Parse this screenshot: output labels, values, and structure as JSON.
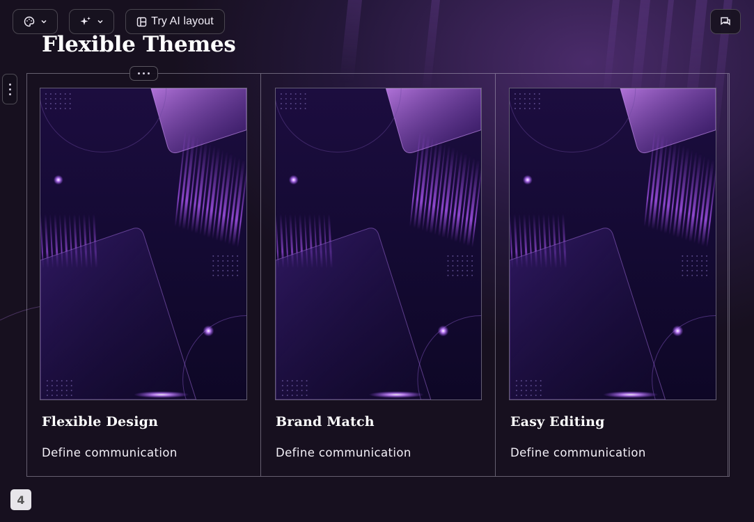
{
  "toolbar": {
    "theme_icon": "palette-icon",
    "ai_icon": "sparkles-icon",
    "layout_icon": "layout-icon",
    "layout_label": "Try AI layout",
    "comment_icon": "comments-icon",
    "chevron_icon": "chevron-down-icon"
  },
  "slide": {
    "title": "Flexible Themes",
    "page_number": "4",
    "cards": [
      {
        "title": "Flexible Design",
        "description": "Define communication"
      },
      {
        "title": "Brand Match",
        "description": "Define communication"
      },
      {
        "title": "Easy Editing",
        "description": "Define communication"
      }
    ]
  },
  "colors": {
    "background": "#1a1225",
    "accent": "#a050ff",
    "card_border": "#8e8896"
  }
}
